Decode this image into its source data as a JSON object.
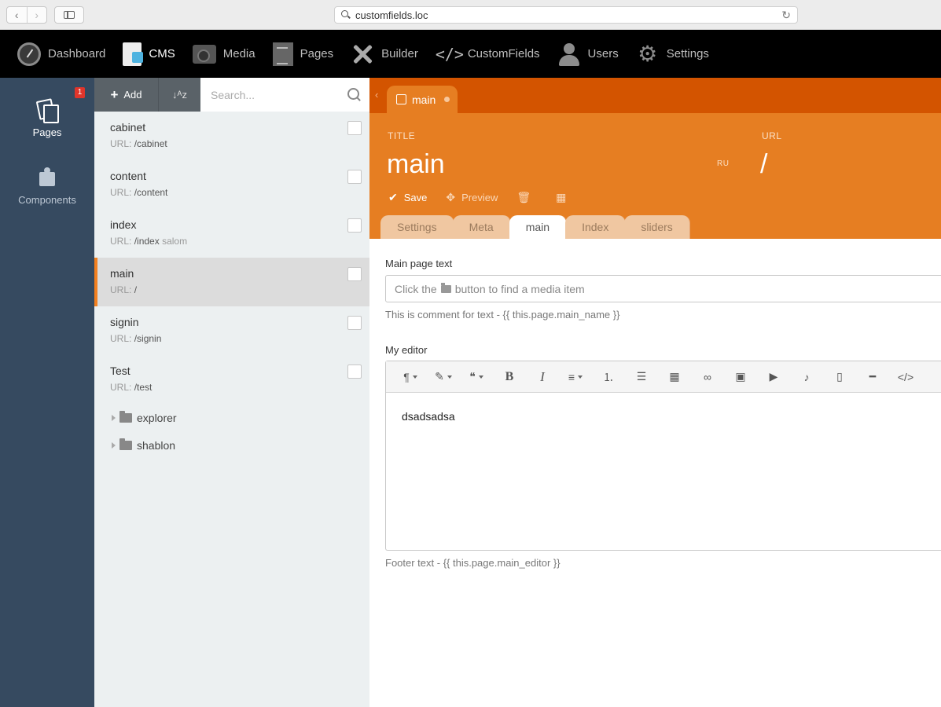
{
  "browser": {
    "url": "customfields.loc"
  },
  "topnav": {
    "items": [
      {
        "label": "Dashboard",
        "icon": "dashboard-gauge-icon"
      },
      {
        "label": "CMS",
        "icon": "cms-icon",
        "active": true
      },
      {
        "label": "Media",
        "icon": "media-camera-icon"
      },
      {
        "label": "Pages",
        "icon": "pages-icon"
      },
      {
        "label": "Builder",
        "icon": "builder-tools-icon"
      },
      {
        "label": "CustomFields",
        "icon": "code-icon"
      },
      {
        "label": "Users",
        "icon": "user-icon"
      },
      {
        "label": "Settings",
        "icon": "settings-gear-icon"
      }
    ]
  },
  "leftbar": {
    "items": [
      {
        "label": "Pages",
        "badge": "1"
      },
      {
        "label": "Components"
      }
    ]
  },
  "list": {
    "add_label": "Add",
    "sort_label": "↓ᴬz",
    "search_placeholder": "Search...",
    "url_prefix": "URL:",
    "pages": [
      {
        "title": "cabinet",
        "url": "/cabinet",
        "extra": ""
      },
      {
        "title": "content",
        "url": "/content",
        "extra": ""
      },
      {
        "title": "index",
        "url": "/index",
        "extra": "salom"
      },
      {
        "title": "main",
        "url": "/",
        "extra": ""
      },
      {
        "title": "signin",
        "url": "/signin",
        "extra": ""
      },
      {
        "title": "Test",
        "url": "/test",
        "extra": ""
      }
    ],
    "folders": [
      "explorer",
      "shablon"
    ]
  },
  "editor": {
    "doc_tab": "main",
    "title_label": "TITLE",
    "title_value": "main",
    "lang": "RU",
    "url_label": "URL",
    "url_value": "/",
    "save_label": "Save",
    "preview_label": "Preview",
    "tabs": [
      "Settings",
      "Meta",
      "main",
      "Index",
      "sliders"
    ],
    "active_tab": "main",
    "field1_label": "Main page text",
    "field1_placeholder_a": "Click the",
    "field1_placeholder_b": "button to find a media item",
    "field1_comment": "This is comment for text - {{ this.page.main_name }}",
    "field2_label": "My editor",
    "field2_content": "dsadsadsa",
    "field2_footer": "Footer text - {{ this.page.main_editor }}"
  },
  "colors": {
    "accent": "#e67e22",
    "accent_dark": "#d35400",
    "sidebar": "#364a60"
  }
}
